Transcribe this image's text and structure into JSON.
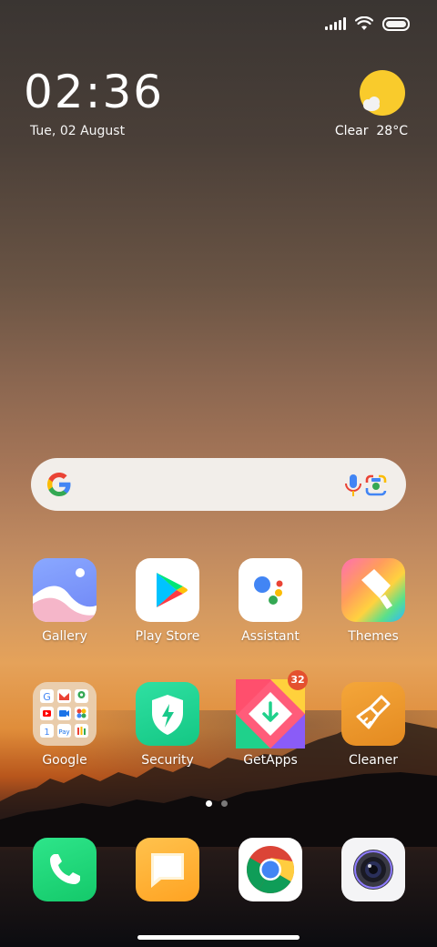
{
  "status": {
    "icons": [
      "signal-icon",
      "wifi-icon",
      "battery-icon"
    ]
  },
  "clock": {
    "time": "02:36",
    "date": "Tue, 02 August"
  },
  "weather": {
    "condition": "Clear",
    "temperature": "28°C",
    "text": "Clear  28°C",
    "icon": "partly-cloudy-sun-icon"
  },
  "search": {
    "icons": [
      "google-g-icon",
      "mic-icon",
      "lens-icon"
    ]
  },
  "apps_row1": [
    {
      "label": "Gallery",
      "icon": "gallery-icon"
    },
    {
      "label": "Play Store",
      "icon": "play-store-icon"
    },
    {
      "label": "Assistant",
      "icon": "assistant-icon"
    },
    {
      "label": "Themes",
      "icon": "themes-icon"
    }
  ],
  "apps_row2": [
    {
      "label": "Google",
      "icon": "google-folder-icon"
    },
    {
      "label": "Security",
      "icon": "security-icon"
    },
    {
      "label": "GetApps",
      "icon": "getapps-icon",
      "badge": "32"
    },
    {
      "label": "Cleaner",
      "icon": "cleaner-icon"
    }
  ],
  "page_indicator": {
    "pages": 2,
    "current": 1
  },
  "dock": [
    {
      "icon": "phone-icon"
    },
    {
      "icon": "messages-icon"
    },
    {
      "icon": "chrome-icon"
    },
    {
      "icon": "camera-icon"
    }
  ],
  "colors": {
    "badge": "#e4502e",
    "phone": "#1ed67a",
    "messages": "#ffb43a"
  }
}
